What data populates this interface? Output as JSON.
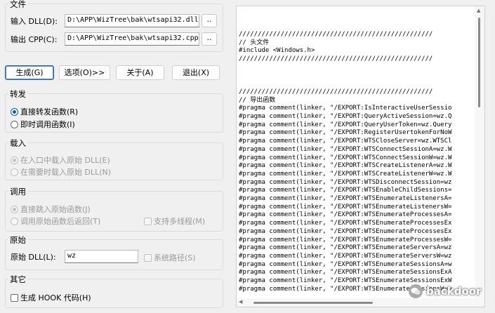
{
  "file_group": {
    "title": "文件",
    "input_label": "输入 DLL(D):",
    "input_value": "D:\\APP\\WizTree\\bak\\wtsapi32.dll",
    "output_label": "输出 CPP(C):",
    "output_value": "D:\\APP\\WizTree\\bak\\wtsapi32.cpp",
    "browse_label": ".."
  },
  "buttons": {
    "generate": "生成(G)",
    "options": "选项(O)>>",
    "about": "关于(A)",
    "exit": "退出(X)"
  },
  "forward_group": {
    "title": "转发",
    "direct": "直接转发函数(R)",
    "immediate": "即时调用函数(I)"
  },
  "load_group": {
    "title": "载入",
    "at_entry": "在入口中载入原始 DLL(E)",
    "on_demand": "在需要时载入原始 DLL(N)"
  },
  "call_group": {
    "title": "调用",
    "jump": "直接跳入原始函数(J)",
    "return_after": "调用原始函数后返回(T)",
    "multithread": "支持多线程(M)"
  },
  "original_group": {
    "title": "原始",
    "dll_label": "原始 DLL(L):",
    "dll_value": "wz",
    "system_path": "系统路径(S)"
  },
  "other_group": {
    "title": "其它",
    "hook_code": "生成 HOOK 代码(H)"
  },
  "code_lines": [
    "///////////////////////////////////////////////////",
    "// 头文件",
    "#include <Windows.h>",
    "///////////////////////////////////////////////////",
    "",
    "",
    "",
    "///////////////////////////////////////////////////",
    "// 导出函数",
    "#pragma comment(linker, \"/EXPORT:IsInteractiveUserSessio",
    "#pragma comment(linker, \"/EXPORT:QueryActiveSession=wz.Q",
    "#pragma comment(linker, \"/EXPORT:QueryUserToken=wz.Query",
    "#pragma comment(linker, \"/EXPORT:RegisterUsertokenForNoW",
    "#pragma comment(linker, \"/EXPORT:WTSCloseServer=wz.WTSCl",
    "#pragma comment(linker, \"/EXPORT:WTSConnectSessionA=wz.W",
    "#pragma comment(linker, \"/EXPORT:WTSConnectSessionW=wz.W",
    "#pragma comment(linker, \"/EXPORT:WTSCreateListenerA=wz.W",
    "#pragma comment(linker, \"/EXPORT:WTSCreateListenerW=wz.W",
    "#pragma comment(linker, \"/EXPORT:WTSDisconnectSession=wz",
    "#pragma comment(linker, \"/EXPORT:WTSEnableChildSessions=",
    "#pragma comment(linker, \"/EXPORT:WTSEnumerateListenersA=",
    "#pragma comment(linker, \"/EXPORT:WTSEnumerateListenersW=",
    "#pragma comment(linker, \"/EXPORT:WTSEnumerateProcessesA=",
    "#pragma comment(linker, \"/EXPORT:WTSEnumerateProcessesEx",
    "#pragma comment(linker, \"/EXPORT:WTSEnumerateProcessesEx",
    "#pragma comment(linker, \"/EXPORT:WTSEnumerateProcessesW=",
    "#pragma comment(linker, \"/EXPORT:WTSEnumerateServersA=wz",
    "#pragma comment(linker, \"/EXPORT:WTSEnumerateServersW=wz",
    "#pragma comment(linker, \"/EXPORT:WTSEnumerateSessionsA=w",
    "#pragma comment(linker, \"/EXPORT:WTSEnumerateSessionsExA",
    "#pragma comment(linker, \"/EXPORT:WTSEnumerateSessionsExW",
    "#pragma comment(linker, \"/EXPORT:WTSEnumerateSessionsW=w"
  ],
  "watermark": "backdoor"
}
